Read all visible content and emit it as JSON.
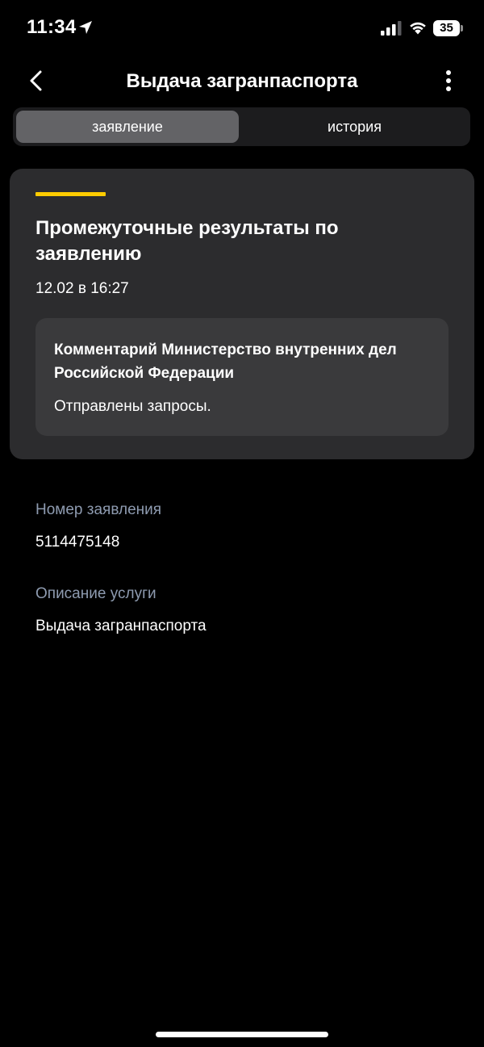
{
  "status_bar": {
    "time": "11:34",
    "battery": "35",
    "icons": [
      "location-arrow-icon",
      "cellular-signal-icon",
      "wifi-icon",
      "battery-icon"
    ]
  },
  "header": {
    "title": "Выдача загранпаспорта",
    "back_icon": "chevron-left-icon",
    "more_icon": "more-vertical-icon"
  },
  "tabs": [
    {
      "label": "заявление",
      "active": true
    },
    {
      "label": "история",
      "active": false
    }
  ],
  "status_card": {
    "accent_color": "#ffcc00",
    "title": "Промежуточные результаты по заявлению",
    "date": "12.02 в 16:27",
    "comment": {
      "author": "Комментарий Министерство внутренних дел Российской Федерации",
      "text": "Отправлены запросы."
    }
  },
  "details": {
    "application_number_label": "Номер заявления",
    "application_number": "5114475148",
    "service_description_label": "Описание услуги",
    "service_description": "Выдача загранпаспорта"
  }
}
